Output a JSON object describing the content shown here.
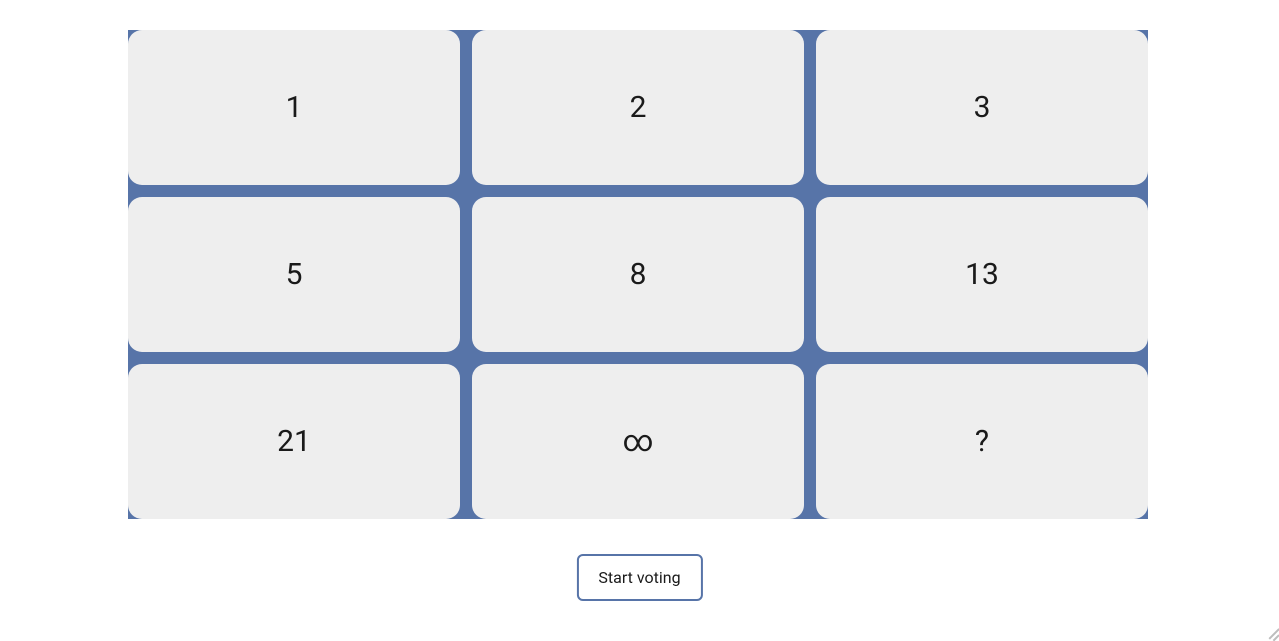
{
  "cards": [
    {
      "label": "1"
    },
    {
      "label": "2"
    },
    {
      "label": "3"
    },
    {
      "label": "5"
    },
    {
      "label": "8"
    },
    {
      "label": "13"
    },
    {
      "label": "21"
    },
    {
      "label": "∞"
    },
    {
      "label": "?"
    }
  ],
  "actions": {
    "start_voting_label": "Start voting"
  }
}
